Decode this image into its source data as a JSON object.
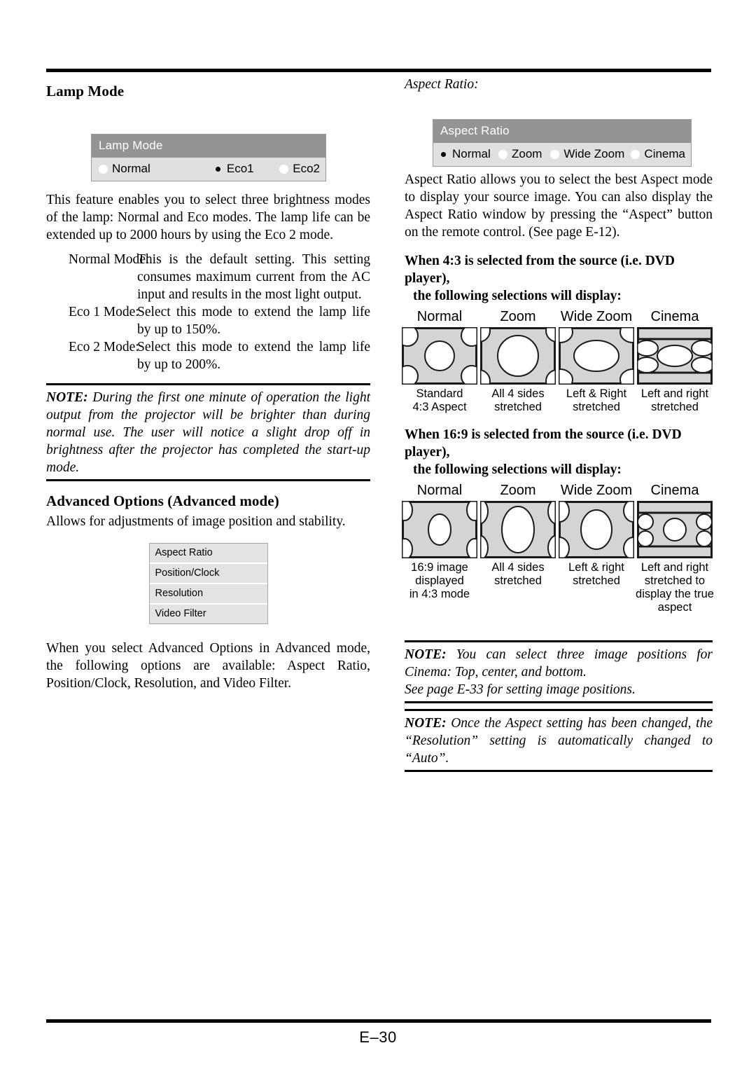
{
  "page": {
    "footer_label": "E–30"
  },
  "left": {
    "lamp_mode": {
      "heading": "Lamp Mode",
      "widget": {
        "title": "Lamp Mode",
        "options": [
          {
            "label": "Normal",
            "selected": false
          },
          {
            "label": "Eco1",
            "selected": true
          },
          {
            "label": "Eco2",
            "selected": false
          }
        ]
      },
      "intro": "This feature enables you to select three brightness modes of the lamp: Normal and Eco modes. The lamp life can be extended up to 2000 hours by using the Eco 2 mode.",
      "definitions": [
        {
          "term": "Normal Mode:",
          "desc": "This is the default setting. This setting consumes maximum current from the AC input and results in the most light output."
        },
        {
          "term": "Eco 1 Mode:",
          "desc": "Select this mode to extend the lamp life by up to 150%."
        },
        {
          "term": "Eco 2 Mode:",
          "desc": "Select this mode to extend the lamp life by up to 200%."
        }
      ],
      "note": {
        "prefix": "NOTE:",
        "text": " During the first one minute of operation the light output from the projector will be brighter than during normal use. The user will notice a slight drop off in brightness after the projector has completed the start-up mode."
      }
    },
    "advanced_options": {
      "heading": "Advanced Options (Advanced mode)",
      "intro": "Allows for adjustments of image position and stability.",
      "menu_items": [
        "Aspect Ratio",
        "Position/Clock",
        "Resolution",
        "Video Filter"
      ],
      "outro": "When you select Advanced Options in Advanced mode, the following options are available: Aspect Ratio, Position/Clock, Resolution, and Video Filter."
    }
  },
  "right": {
    "aspect_ratio_label": "Aspect Ratio:",
    "widget": {
      "title": "Aspect Ratio",
      "options": [
        {
          "label": "Normal",
          "selected": true
        },
        {
          "label": "Zoom",
          "selected": false
        },
        {
          "label": "Wide Zoom",
          "selected": false
        },
        {
          "label": "Cinema",
          "selected": false
        }
      ]
    },
    "intro": "Aspect Ratio allows you to select the best Aspect mode to display your source image. You can also display the Aspect Ratio window by pressing the “Aspect” button on the remote control. (See page E-12).",
    "section_4_3": {
      "heading_line1": "When 4:3 is selected from the source (i.e. DVD player),",
      "heading_line2": "the following selections will display:",
      "cells": [
        {
          "label": "Normal",
          "caption_lines": [
            "Standard",
            "4:3 Aspect"
          ]
        },
        {
          "label": "Zoom",
          "caption_lines": [
            "All 4 sides",
            "stretched"
          ]
        },
        {
          "label": "Wide Zoom",
          "caption_lines": [
            "Left & Right",
            "stretched"
          ]
        },
        {
          "label": "Cinema",
          "caption_lines": [
            "Left and right",
            "stretched"
          ]
        }
      ]
    },
    "section_16_9": {
      "heading_line1": "When 16:9 is selected from the source (i.e. DVD player),",
      "heading_line2": "the following selections will display:",
      "cells": [
        {
          "label": "Normal",
          "caption_lines": [
            "16:9 image",
            "displayed",
            "in 4:3 mode"
          ]
        },
        {
          "label": "Zoom",
          "caption_lines": [
            "All 4 sides",
            "stretched"
          ]
        },
        {
          "label": "Wide Zoom",
          "caption_lines": [
            "Left & right",
            "stretched"
          ]
        },
        {
          "label": "Cinema",
          "caption_lines": [
            "Left and right",
            "stretched to",
            "display the true",
            "aspect"
          ]
        }
      ]
    },
    "note_cinema": {
      "prefix": "NOTE:",
      "text": " You can select three image positions for Cinema: Top, center, and bottom.",
      "line2": "See page E-33 for setting image positions."
    },
    "note_resolution": {
      "prefix": "NOTE:",
      "text": " Once the Aspect setting has been changed, the “Resolution” setting is automatically changed to “Auto”."
    }
  },
  "colors": {
    "osd_title_bg": "#949494",
    "osd_body_bg": "#e0e0e0",
    "menu_item_bg": "#e3e3e3",
    "diagram_fill": "#d4d4d4",
    "rule": "#000000"
  }
}
